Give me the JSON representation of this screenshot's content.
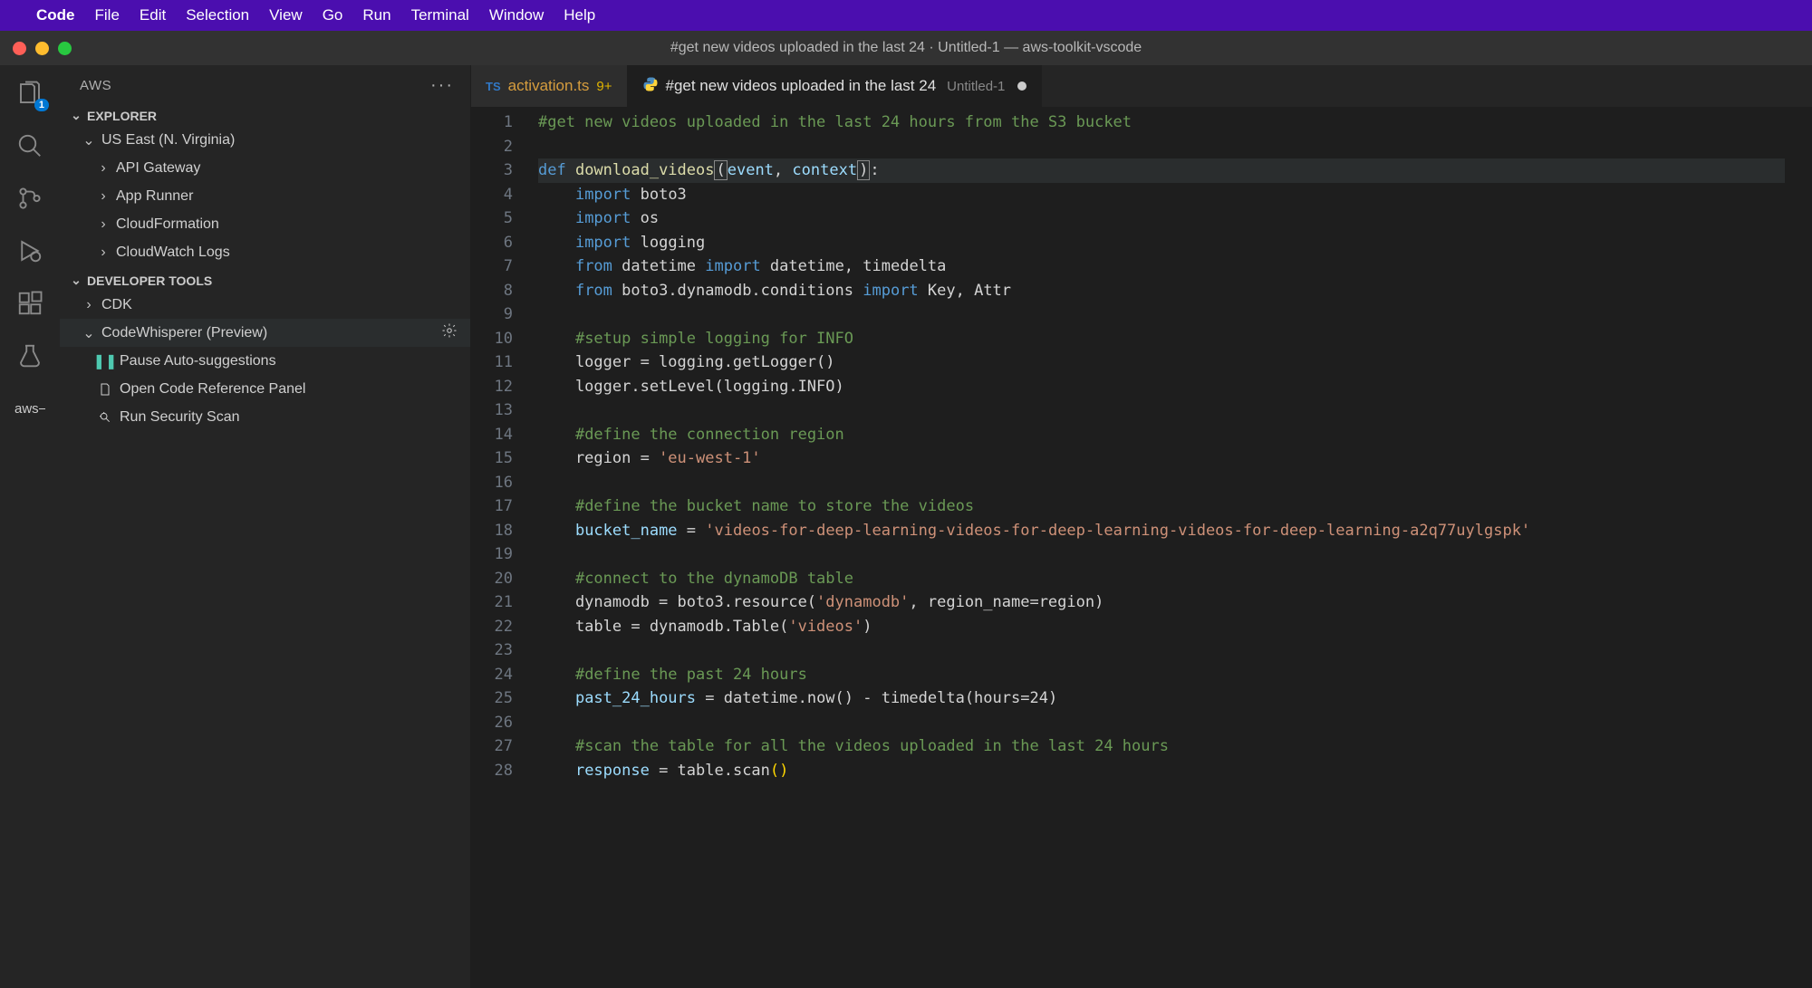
{
  "menubar": {
    "app": "Code",
    "items": [
      "File",
      "Edit",
      "Selection",
      "View",
      "Go",
      "Run",
      "Terminal",
      "Window",
      "Help"
    ]
  },
  "titlebar": "#get new videos uploaded in the last 24 · Untitled-1 — aws-toolkit-vscode",
  "sidebar": {
    "title": "AWS",
    "explorer": {
      "label": "EXPLORER",
      "region": "US East (N. Virginia)",
      "services": [
        "API Gateway",
        "App Runner",
        "CloudFormation",
        "CloudWatch Logs"
      ]
    },
    "devtools": {
      "label": "DEVELOPER TOOLS",
      "items": [
        {
          "label": "CDK",
          "type": "folder"
        },
        {
          "label": "CodeWhisperer (Preview)",
          "type": "folder-open"
        }
      ],
      "cw_items": [
        {
          "icon": "pause",
          "label": "Pause Auto-suggestions"
        },
        {
          "icon": "file",
          "label": "Open Code Reference Panel"
        },
        {
          "icon": "scan",
          "label": "Run Security Scan"
        }
      ]
    }
  },
  "activity_badge": "1",
  "tabs": [
    {
      "icon": "ts",
      "label": "activation.ts",
      "badge": "9+",
      "active": false
    },
    {
      "icon": "py",
      "label": "#get new videos uploaded in the last 24",
      "sub": "Untitled-1",
      "modified": true,
      "active": true
    }
  ],
  "code": {
    "lines": [
      {
        "n": 1,
        "tokens": [
          [
            "#get new videos uploaded in the last 24 hours from the S3 bucket",
            "comment"
          ]
        ]
      },
      {
        "n": 2,
        "tokens": [
          [
            "",
            ""
          ]
        ]
      },
      {
        "n": 3,
        "hl": true,
        "tokens": [
          [
            "def ",
            "keyword"
          ],
          [
            "download_videos",
            "func"
          ],
          [
            "(",
            "box"
          ],
          [
            "event",
            "var"
          ],
          [
            ", ",
            ""
          ],
          [
            "context",
            "var"
          ],
          [
            ")",
            "box"
          ],
          [
            ":",
            ""
          ]
        ]
      },
      {
        "n": 4,
        "tokens": [
          [
            "    ",
            ""
          ],
          [
            "import",
            "keyword"
          ],
          [
            " boto3",
            ""
          ]
        ]
      },
      {
        "n": 5,
        "tokens": [
          [
            "    ",
            ""
          ],
          [
            "import",
            "keyword"
          ],
          [
            " os",
            ""
          ]
        ]
      },
      {
        "n": 6,
        "tokens": [
          [
            "    ",
            ""
          ],
          [
            "import",
            "keyword"
          ],
          [
            " logging",
            ""
          ]
        ]
      },
      {
        "n": 7,
        "tokens": [
          [
            "    ",
            ""
          ],
          [
            "from",
            "keyword"
          ],
          [
            " datetime ",
            ""
          ],
          [
            "import",
            "keyword"
          ],
          [
            " datetime, timedelta",
            ""
          ]
        ]
      },
      {
        "n": 8,
        "tokens": [
          [
            "    ",
            ""
          ],
          [
            "from",
            "keyword"
          ],
          [
            " boto3.dynamodb.conditions ",
            ""
          ],
          [
            "import",
            "keyword"
          ],
          [
            " Key, Attr",
            ""
          ]
        ]
      },
      {
        "n": 9,
        "tokens": [
          [
            "",
            ""
          ]
        ]
      },
      {
        "n": 10,
        "tokens": [
          [
            "    ",
            ""
          ],
          [
            "#setup simple logging for INFO",
            "comment"
          ]
        ]
      },
      {
        "n": 11,
        "tokens": [
          [
            "    logger = logging.getLogger()",
            ""
          ]
        ]
      },
      {
        "n": 12,
        "tokens": [
          [
            "    logger.setLevel(logging.INFO)",
            ""
          ]
        ]
      },
      {
        "n": 13,
        "tokens": [
          [
            "",
            ""
          ]
        ]
      },
      {
        "n": 14,
        "tokens": [
          [
            "    ",
            ""
          ],
          [
            "#define the connection region",
            "comment"
          ]
        ]
      },
      {
        "n": 15,
        "tokens": [
          [
            "    region = ",
            ""
          ],
          [
            "'eu-west-1'",
            "str"
          ]
        ]
      },
      {
        "n": 16,
        "tokens": [
          [
            "",
            ""
          ]
        ]
      },
      {
        "n": 17,
        "tokens": [
          [
            "    ",
            ""
          ],
          [
            "#define the bucket name to store the videos",
            "comment"
          ]
        ]
      },
      {
        "n": 18,
        "tokens": [
          [
            "    ",
            ""
          ],
          [
            "bucket_name",
            "var"
          ],
          [
            " = ",
            ""
          ],
          [
            "'videos-for-deep-learning-videos-for-deep-learning-videos-for-deep-learning-a2q77uylgspk'",
            "str"
          ]
        ]
      },
      {
        "n": 19,
        "tokens": [
          [
            "",
            ""
          ]
        ]
      },
      {
        "n": 20,
        "tokens": [
          [
            "    ",
            ""
          ],
          [
            "#connect to the dynamoDB table",
            "comment"
          ]
        ]
      },
      {
        "n": 21,
        "tokens": [
          [
            "    dynamodb = boto3.resource(",
            ""
          ],
          [
            "'dynamodb'",
            "str"
          ],
          [
            ", region_name=region)",
            ""
          ]
        ]
      },
      {
        "n": 22,
        "tokens": [
          [
            "    table = dynamodb.Table(",
            ""
          ],
          [
            "'videos'",
            "str"
          ],
          [
            ")",
            ""
          ]
        ]
      },
      {
        "n": 23,
        "tokens": [
          [
            "",
            ""
          ]
        ]
      },
      {
        "n": 24,
        "tokens": [
          [
            "    ",
            ""
          ],
          [
            "#define the past 24 hours",
            "comment"
          ]
        ]
      },
      {
        "n": 25,
        "tokens": [
          [
            "    ",
            ""
          ],
          [
            "past_24_hours",
            "var"
          ],
          [
            " = datetime.now() - timedelta(hours=",
            ""
          ],
          [
            "24",
            ""
          ],
          [
            ")",
            ""
          ]
        ]
      },
      {
        "n": 26,
        "tokens": [
          [
            "",
            ""
          ]
        ]
      },
      {
        "n": 27,
        "tokens": [
          [
            "    ",
            ""
          ],
          [
            "#scan the table for all the videos uploaded in the last 24 hours",
            "comment"
          ]
        ]
      },
      {
        "n": 28,
        "tokens": [
          [
            "    ",
            ""
          ],
          [
            "response",
            "var"
          ],
          [
            " = table.scan",
            ""
          ],
          [
            "()",
            "paren-hl"
          ]
        ]
      }
    ]
  }
}
